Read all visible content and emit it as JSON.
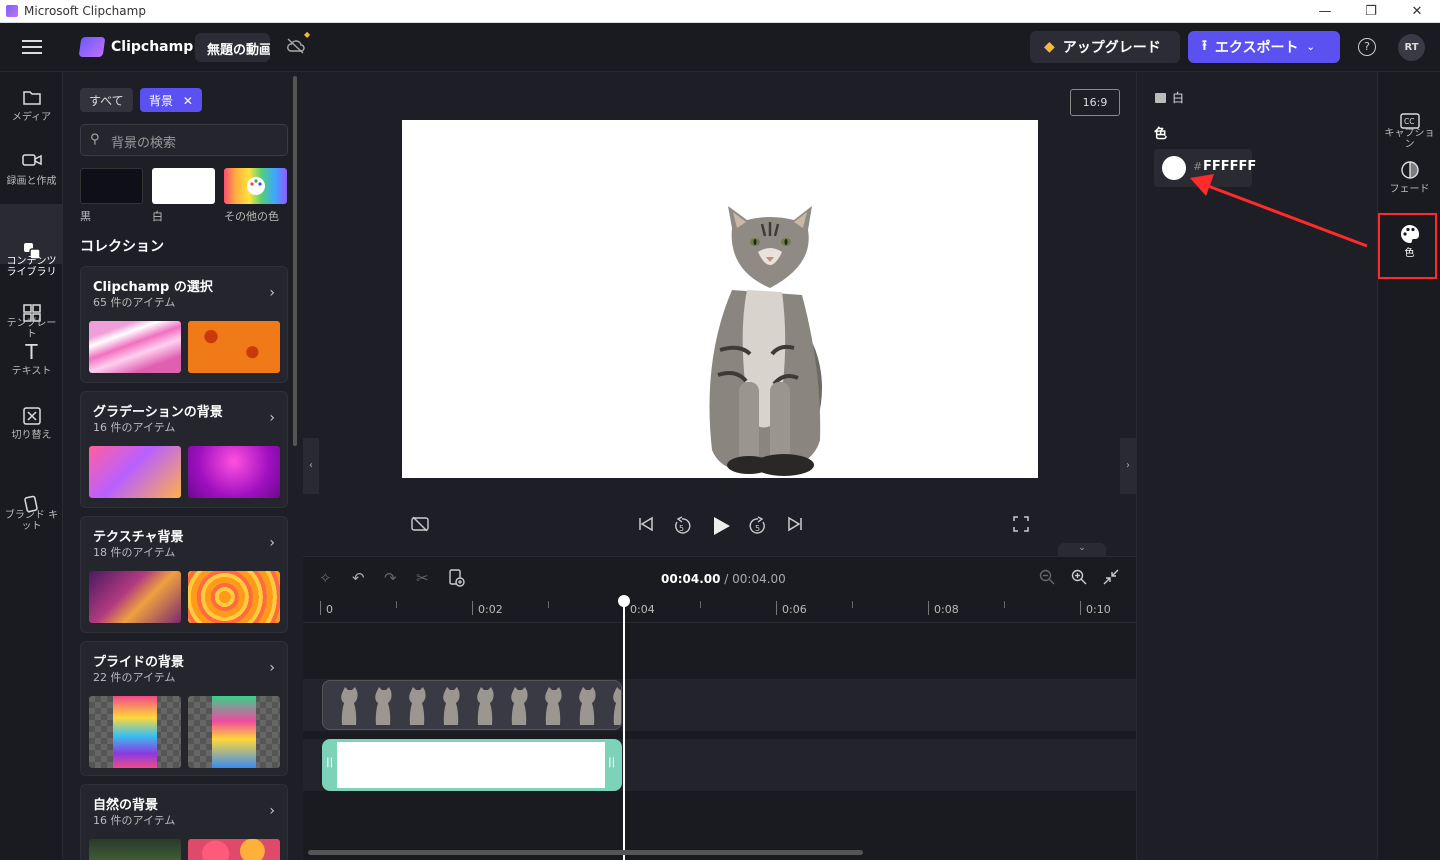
{
  "window": {
    "title": "Microsoft Clipchamp"
  },
  "header": {
    "app_name": "Clipchamp",
    "project_name": "無題の動画",
    "upgrade_label": "アップグレード",
    "export_label": "エクスポート",
    "help": "?",
    "avatar_initials": "RT"
  },
  "left_rail": {
    "items": [
      {
        "label": "メディア"
      },
      {
        "label": "録画と作成"
      },
      {
        "label": "コンテンツ\nライブラリ"
      },
      {
        "label": "テンプレー\nト"
      },
      {
        "label": "テキスト"
      },
      {
        "label": "切り替え"
      },
      {
        "label": "ブランド キ\nット"
      }
    ]
  },
  "library": {
    "filter_all": "すべて",
    "filter_active": "背景",
    "search_placeholder": "背景の検索",
    "swatches": [
      {
        "label": "黒",
        "color": "#0f0f18"
      },
      {
        "label": "白",
        "color": "#ffffff"
      },
      {
        "label": "その他の色"
      }
    ],
    "collections_title": "コレクション",
    "collections": [
      {
        "title": "Clipchamp の選択",
        "count": "65 件のアイテム"
      },
      {
        "title": "グラデーションの背景",
        "count": "16 件のアイテム"
      },
      {
        "title": "テクスチャ背景",
        "count": "18 件のアイテム"
      },
      {
        "title": "プライドの背景",
        "count": "22 件のアイテム"
      },
      {
        "title": "自然の背景",
        "count": "16 件のアイテム"
      }
    ]
  },
  "preview": {
    "aspect_ratio": "16:9"
  },
  "timeline": {
    "current_time": "00:04.00",
    "separator": " / ",
    "duration": "00:04.00",
    "ruler_labels": [
      "0",
      "0:02",
      "0:04",
      "0:06",
      "0:08",
      "0:10"
    ]
  },
  "properties": {
    "selected_item": "白",
    "color_label": "色",
    "color_hash": "#",
    "color_hex": "FFFFFF"
  },
  "right_rail": {
    "items": [
      {
        "label": "キャプショ\nン"
      },
      {
        "label": "フェード"
      },
      {
        "label": "色"
      }
    ]
  },
  "colors": {
    "accent": "#5b50f0",
    "highlight": "#ff2a2a",
    "background_clip": "#7dd3b8"
  }
}
